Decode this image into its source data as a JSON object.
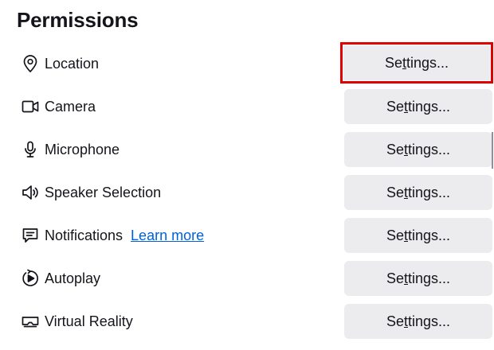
{
  "section": {
    "title": "Permissions"
  },
  "settings_button": {
    "pre": "Se",
    "accesskey": "t",
    "post": "tings..."
  },
  "permissions": [
    {
      "label": "Location",
      "icon": "location-pin-icon"
    },
    {
      "label": "Camera",
      "icon": "camera-icon"
    },
    {
      "label": "Microphone",
      "icon": "microphone-icon"
    },
    {
      "label": "Speaker Selection",
      "icon": "speaker-icon"
    },
    {
      "label": "Notifications",
      "icon": "notification-bubble-icon",
      "link": "Learn more"
    },
    {
      "label": "Autoplay",
      "icon": "autoplay-icon"
    },
    {
      "label": "Virtual Reality",
      "icon": "vr-headset-icon"
    }
  ],
  "colors": {
    "focus_outline": "#e00000",
    "link": "#0061e0",
    "button_bg": "#ececee"
  }
}
